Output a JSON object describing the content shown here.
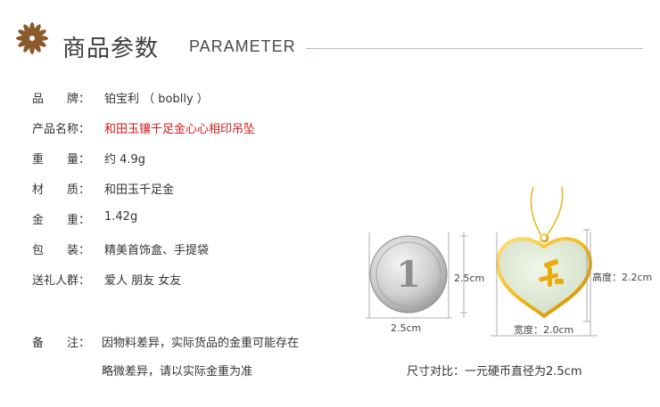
{
  "header": {
    "title_cn": "商品参数",
    "title_en": "PARAMETER"
  },
  "params": [
    {
      "label": "品　　牌：",
      "value": "铂宝利 （ boblly ）",
      "highlight": false
    },
    {
      "label": "产品名称：",
      "value": "和田玉镶千足金心心相印吊坠",
      "highlight": true
    },
    {
      "label": "重　　量：",
      "value": "约 4.9g",
      "highlight": false
    },
    {
      "label": "材　　质：",
      "value": "和田玉千足金",
      "highlight": false
    },
    {
      "label": "金　　重：",
      "value": "1.42g",
      "highlight": false
    },
    {
      "label": "包　　装：",
      "value": "精美首饰盒、手提袋",
      "highlight": false
    },
    {
      "label": "送礼人群：",
      "value": "爱人 朋友 女友",
      "highlight": false
    }
  ],
  "note": {
    "label": "备　　注：",
    "line1": "因物料差异，实际货品的金重可能存在",
    "line2": "略微差异，请以实际金重为准"
  },
  "figure": {
    "coin_width": "2.5cm",
    "coin_height": "2.5cm",
    "pendant_width": "宽度：2.0cm",
    "pendant_height": "高度：2.2cm",
    "caption": "尺寸对比：一元硬币直径为2.5cm"
  },
  "colors": {
    "accent": "#8a5a2b",
    "highlight": "#d11a1a",
    "rule": "#c9b9a3"
  },
  "icons": {
    "header": "flower-icon"
  }
}
